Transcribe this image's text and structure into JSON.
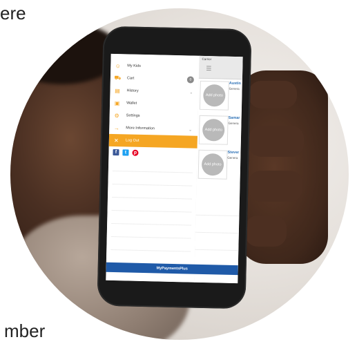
{
  "captions": {
    "top": "ere",
    "bottom": "mber"
  },
  "status": {
    "carrier": "Carrier"
  },
  "menu": {
    "items": [
      {
        "label": "My Kids",
        "icon": "kids-icon"
      },
      {
        "label": "Cart",
        "icon": "cart-icon",
        "badge": "0"
      },
      {
        "label": "History",
        "icon": "history-icon",
        "chevron": true
      },
      {
        "label": "Wallet",
        "icon": "wallet-icon"
      },
      {
        "label": "Settings",
        "icon": "settings-icon"
      },
      {
        "label": "More Information",
        "icon": "arrow-right-icon",
        "chevron": true
      },
      {
        "label": "Log Out",
        "icon": "logout-icon",
        "highlight": true
      }
    ],
    "social": [
      "facebook-icon",
      "twitter-icon",
      "pinterest-icon"
    ]
  },
  "kids": [
    {
      "name": "Austin",
      "sub": "Genera",
      "photo": "Add photo"
    },
    {
      "name": "Samar",
      "sub": "Genera",
      "photo": "Add photo"
    },
    {
      "name": "Stever",
      "sub": "Genera",
      "photo": "Add photo"
    }
  ],
  "footer": {
    "brand": "MyPaymentsPlus"
  },
  "colors": {
    "accent": "#f5a623",
    "brand": "#1f5aa8",
    "link": "#2a6fb5"
  }
}
